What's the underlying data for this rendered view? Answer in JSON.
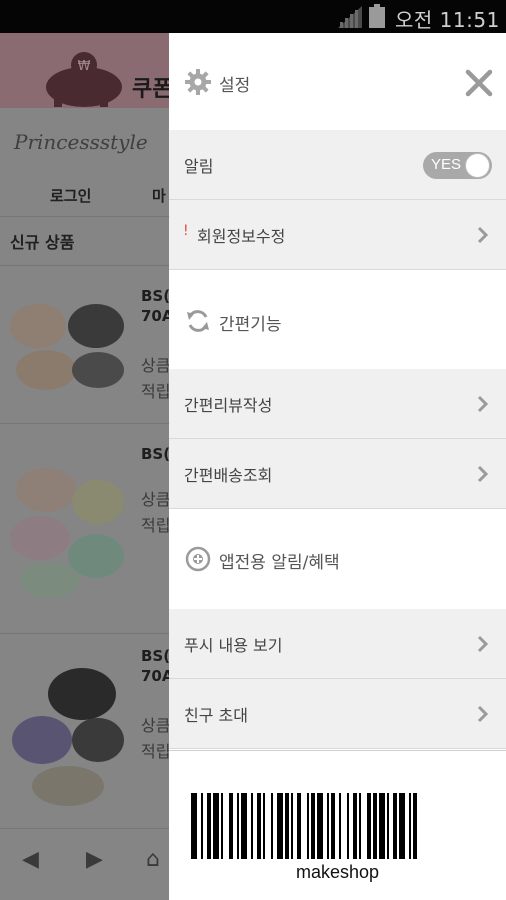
{
  "status_bar": {
    "time": "오전 11:51"
  },
  "background_app": {
    "coupon_label": "쿠폰",
    "logo_text": "Princessstyle",
    "nav": {
      "login": "로그인",
      "next": "마"
    },
    "section_title": "신규 상품",
    "products": [
      {
        "code": "BS(",
        "code_line2": "70A",
        "desc1": "상큼",
        "desc2": "적립"
      },
      {
        "code": "BS(",
        "code_line2": "",
        "desc1": "상큼",
        "desc2": "적립"
      },
      {
        "code": "BS(",
        "code_line2": "70A",
        "desc1": "상큼",
        "desc2": "적립"
      }
    ]
  },
  "drawer": {
    "title": "설정",
    "icons": {
      "settings": "gear-icon",
      "close": "close-icon",
      "quick": "refresh-icon",
      "app_only": "plus-circle-icon",
      "chevron": "chevron-right-icon"
    },
    "notification": {
      "label": "알림",
      "toggle_text": "YES"
    },
    "member_edit": {
      "mark": "!",
      "label": "회원정보수정"
    },
    "quick_section": {
      "title": "간편기능"
    },
    "quick_items": [
      {
        "label": "간편리뷰작성"
      },
      {
        "label": "간편배송조회"
      }
    ],
    "app_section": {
      "title": "앱전용 알림/혜택"
    },
    "app_items": [
      {
        "label": "푸시 내용 보기"
      },
      {
        "label": "친구 초대"
      }
    ],
    "barcode_text": "makeshop"
  },
  "colors": {
    "drawer_bg": "#ffffff",
    "item_bg": "#f0f0f0",
    "toggle_bg": "#a9a9a9",
    "overlay": "#7d7d7d"
  }
}
